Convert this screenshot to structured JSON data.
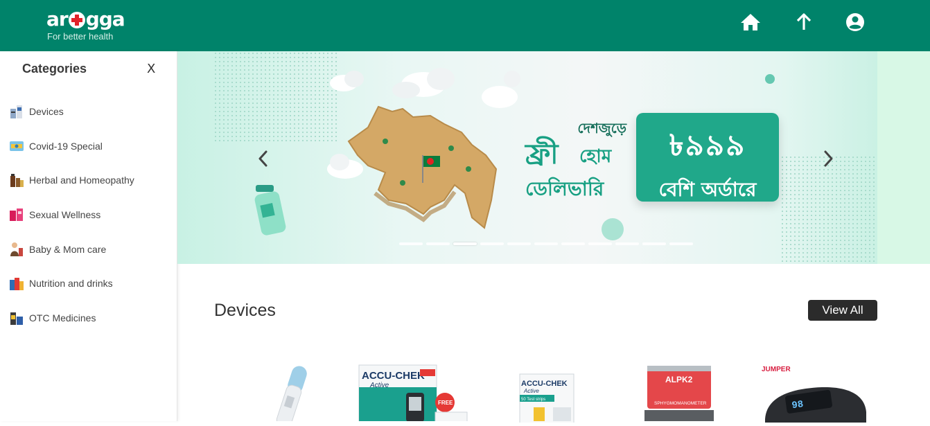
{
  "header": {
    "logo_word_left": "ar",
    "logo_word_right": "gga",
    "tagline": "For better health",
    "icons": [
      "home-icon",
      "arrow-up-icon",
      "account-icon"
    ]
  },
  "sidebar": {
    "title": "Categories",
    "close_label": "X",
    "items": [
      {
        "label": "Devices",
        "icon": "devices-thumb"
      },
      {
        "label": "Covid-19 Special",
        "icon": "covid-thumb"
      },
      {
        "label": "Herbal and Homeopathy",
        "icon": "herbal-thumb"
      },
      {
        "label": "Sexual Wellness",
        "icon": "wellness-thumb"
      },
      {
        "label": "Baby & Mom care",
        "icon": "baby-thumb"
      },
      {
        "label": "Nutrition and drinks",
        "icon": "nutrition-thumb"
      },
      {
        "label": "OTC Medicines",
        "icon": "otc-thumb"
      }
    ]
  },
  "banner": {
    "line1": "দেশজুড়ে",
    "line2": "ফ্রী",
    "line3": "হোম",
    "line4": "ডেলিভারি",
    "price": "৳৯৯৯",
    "price_sub": "বেশি অর্ডারে",
    "slide_count": 11,
    "active_slide": 3
  },
  "devices": {
    "title": "Devices",
    "view_all": "View All",
    "products": [
      {
        "name": "thermometer"
      },
      {
        "name": "ACCU-CHEK Active kit",
        "brand": "ACCU-CHEK",
        "sub": "Active",
        "badge": "FREE"
      },
      {
        "name": "ACCU-CHEK Active test strips",
        "brand": "ACCU-CHEK",
        "sub": "Active",
        "note": "50 Test strips"
      },
      {
        "name": "ALPK2 sphygmomanometer",
        "brand": "ALPK2",
        "note": "SPHYGMOMANOMETER"
      },
      {
        "name": "JUMPER pulse oximeter",
        "brand": "JUMPER",
        "reading": "98"
      }
    ]
  },
  "colors": {
    "brand_green": "#00836a",
    "promo_green": "#20a88a",
    "dark_button": "#2b2b2b"
  }
}
